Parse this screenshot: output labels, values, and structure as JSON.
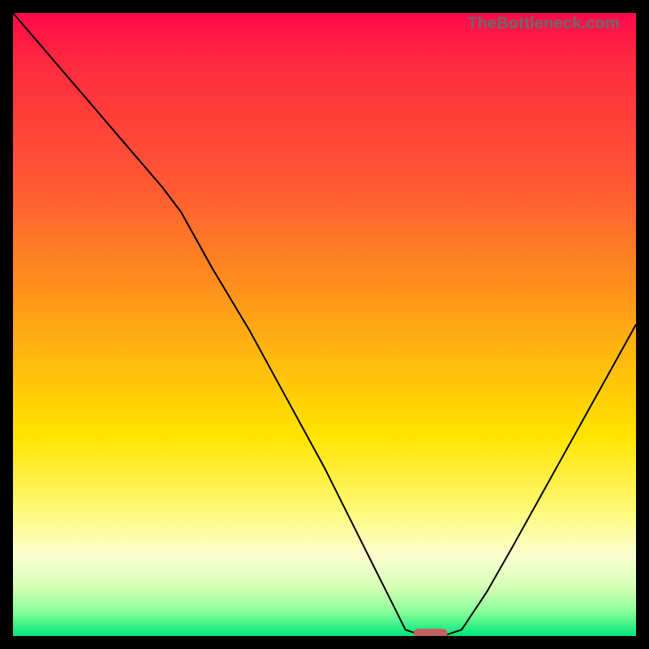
{
  "watermark": "TheBottleneck.com",
  "colors": {
    "frame": "#000000",
    "curve": "#000000",
    "marker": "#c46060"
  },
  "chart_data": {
    "type": "line",
    "title": "",
    "xlabel": "",
    "ylabel": "",
    "xlim": [
      0,
      100
    ],
    "ylim": [
      0,
      100
    ],
    "x": [
      0,
      6,
      12,
      18,
      24,
      27,
      32,
      38,
      44,
      50,
      54,
      58,
      61,
      63,
      66,
      69,
      72,
      76,
      80,
      85,
      90,
      95,
      100
    ],
    "values": [
      100,
      93,
      86,
      79,
      72,
      68,
      59,
      49,
      38,
      27,
      19,
      11,
      5,
      1,
      0,
      0,
      1,
      7,
      14,
      23,
      32,
      41,
      50
    ],
    "optimum_x": 67,
    "optimum_y": 0
  }
}
